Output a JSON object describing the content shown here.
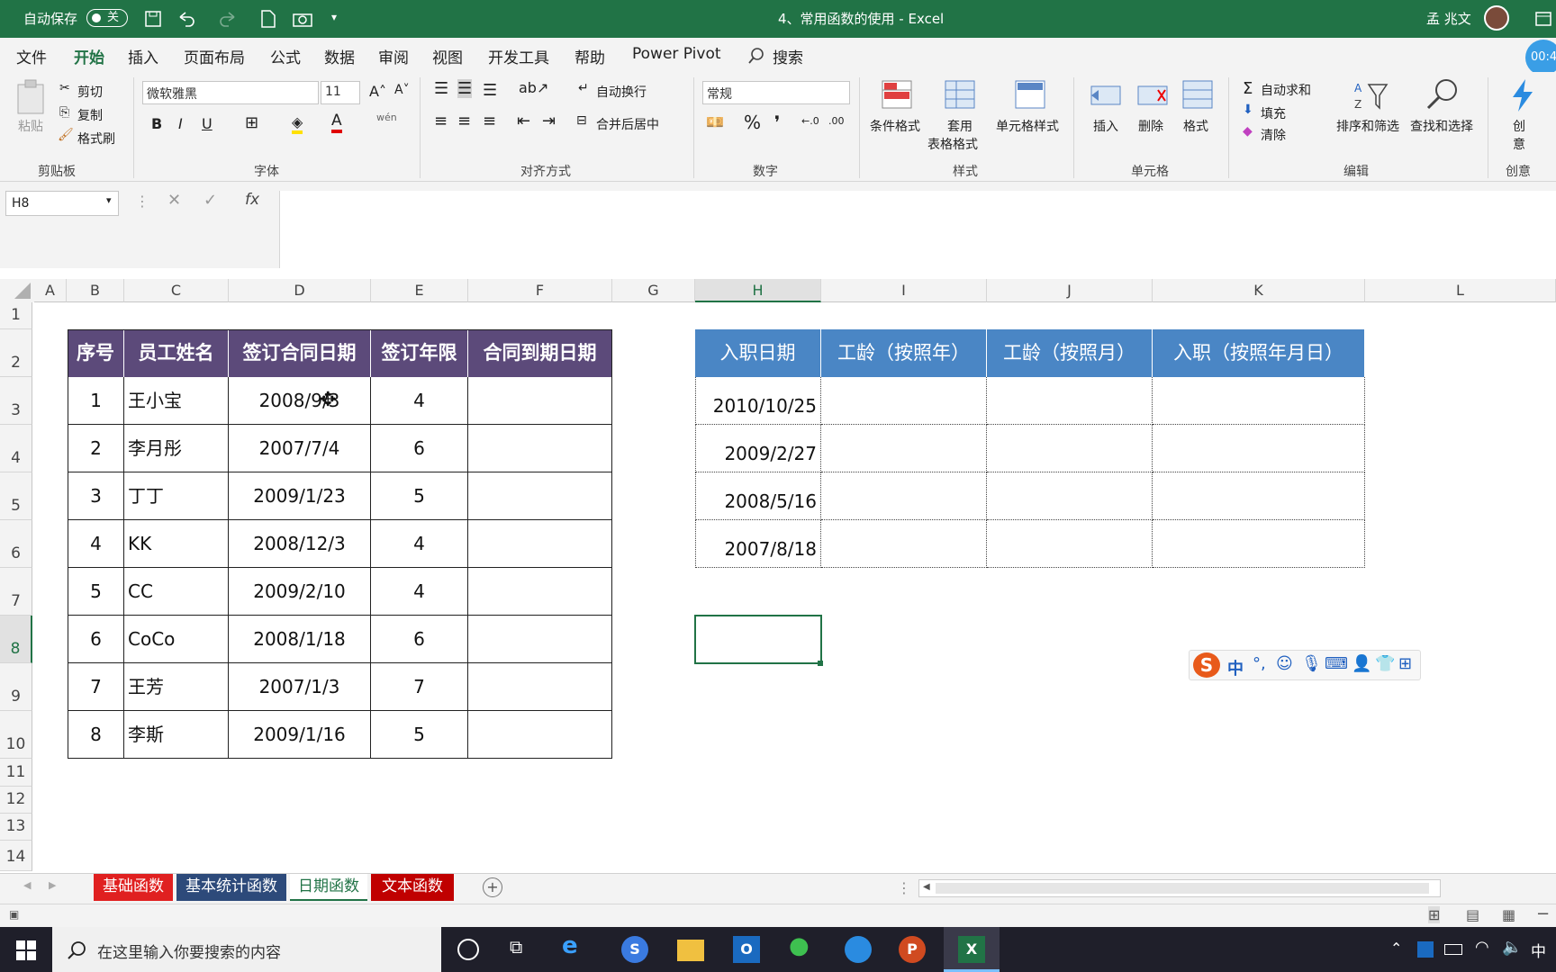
{
  "titlebar": {
    "autosave_label": "自动保存",
    "autosave_state": "关",
    "doc_title": "4、常用函数的使用 - Excel",
    "user_name": "孟 兆文"
  },
  "menu": [
    "文件",
    "开始",
    "插入",
    "页面布局",
    "公式",
    "数据",
    "审阅",
    "视图",
    "开发工具",
    "帮助",
    "Power Pivot",
    "搜索"
  ],
  "ribbon": {
    "clipboard": {
      "paste": "粘贴",
      "cut": "剪切",
      "copy": "复制",
      "format_painter": "格式刷",
      "group": "剪贴板"
    },
    "font": {
      "name": "微软雅黑",
      "size": "11",
      "group": "字体"
    },
    "align": {
      "wrap": "自动换行",
      "merge": "合并后居中",
      "group": "对齐方式"
    },
    "number": {
      "format": "常规",
      "group": "数字"
    },
    "styles": {
      "cond": "条件格式",
      "table1": "套用",
      "table2": "表格格式",
      "cell_style": "单元格样式",
      "group": "样式"
    },
    "cells": {
      "insert": "插入",
      "delete": "删除",
      "format": "格式",
      "group": "单元格"
    },
    "edit": {
      "autosum": "自动求和",
      "fill": "填充",
      "clear": "清除",
      "sort": "排序和筛选",
      "find": "查找和选择",
      "group": "编辑"
    },
    "create": {
      "label1": "创",
      "label2": "意",
      "group": "创意"
    },
    "timer": "00:4"
  },
  "formula_bar": {
    "namebox": "H8",
    "fx": "fx"
  },
  "columns": [
    "A",
    "B",
    "C",
    "D",
    "E",
    "F",
    "G",
    "H",
    "I",
    "J",
    "K",
    "L"
  ],
  "rows": [
    "1",
    "2",
    "3",
    "4",
    "5",
    "6",
    "7",
    "8",
    "9",
    "10",
    "11",
    "12",
    "13",
    "14"
  ],
  "table1": {
    "headers": [
      "序号",
      "员工姓名",
      "签订合同日期",
      "签订年限",
      "合同到期日期"
    ],
    "rows": [
      [
        "1",
        "王小宝",
        "2008/9/3",
        "4",
        ""
      ],
      [
        "2",
        "李月彤",
        "2007/7/4",
        "6",
        ""
      ],
      [
        "3",
        "丁丁",
        "2009/1/23",
        "5",
        ""
      ],
      [
        "4",
        "KK",
        "2008/12/3",
        "4",
        ""
      ],
      [
        "5",
        "CC",
        "2009/2/10",
        "4",
        ""
      ],
      [
        "6",
        "CoCo",
        "2008/1/18",
        "6",
        ""
      ],
      [
        "7",
        "王芳",
        "2007/1/3",
        "7",
        ""
      ],
      [
        "8",
        "李斯",
        "2009/1/16",
        "5",
        ""
      ]
    ]
  },
  "table2": {
    "headers": [
      "入职日期",
      "工龄（按照年）",
      "工龄（按照月）",
      "入职（按照年月日）"
    ],
    "rows": [
      [
        "2010/10/25"
      ],
      [
        "2009/2/27"
      ],
      [
        "2008/5/16"
      ],
      [
        "2007/8/18"
      ]
    ]
  },
  "ime": {
    "label": "中"
  },
  "sheets": [
    {
      "name": "基础函数",
      "bg": "#e02020",
      "fg": "#ffffff"
    },
    {
      "name": "基本统计函数",
      "bg": "#2d4a7a",
      "fg": "#ffffff"
    },
    {
      "name": "日期函数",
      "bg": "#ffffff",
      "fg": "#217346"
    },
    {
      "name": "文本函数",
      "bg": "#c00000",
      "fg": "#ffffff"
    }
  ],
  "taskbar": {
    "search_placeholder": "在这里输入你要搜索的内容",
    "ime": "中"
  },
  "colors": {
    "excel_green": "#217346",
    "header_purple": "#5c4a7a",
    "header_blue": "#4a86c5"
  }
}
